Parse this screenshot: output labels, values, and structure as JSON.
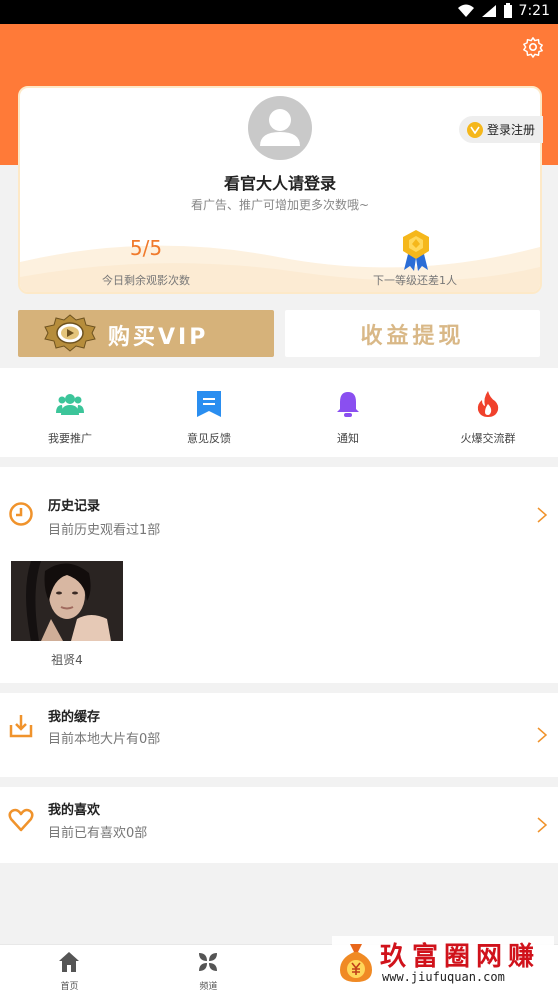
{
  "status_bar": {
    "time": "7:21"
  },
  "profile": {
    "login_title": "看官大人请登录",
    "login_subtitle": "看广告、推广可增加更多次数哦~",
    "views_remaining_value": "5/5",
    "views_remaining_label": "今日剩余观影次数",
    "next_level_label": "下一等级还差1人",
    "login_register_label": "登录注册"
  },
  "actions": {
    "buy_vip_label": "购买VIP",
    "withdraw_label": "收益提现"
  },
  "quick_links": [
    {
      "label": "我要推广",
      "icon": "team-icon",
      "color": "#3cc59a"
    },
    {
      "label": "意见反馈",
      "icon": "feedback-icon",
      "color": "#2a8ef0"
    },
    {
      "label": "通知",
      "icon": "bell-icon",
      "color": "#8a4ff0"
    },
    {
      "label": "火爆交流群",
      "icon": "flame-icon",
      "color": "#f0412c"
    }
  ],
  "history": {
    "title": "历史记录",
    "subtitle": "目前历史观看过1部",
    "items": [
      {
        "title": "祖贤4"
      }
    ]
  },
  "cache": {
    "title": "我的缓存",
    "subtitle": "目前本地大片有0部"
  },
  "favorites": {
    "title": "我的喜欢",
    "subtitle": "目前已有喜欢0部"
  },
  "bottom_nav": [
    {
      "label": "首页",
      "icon": "home-icon"
    },
    {
      "label": "频道",
      "icon": "channel-icon"
    },
    {
      "label": "",
      "icon": ""
    },
    {
      "label": "",
      "icon": ""
    }
  ],
  "watermark": {
    "title": "玖富圈网赚",
    "url": "www.jiufuquan.com"
  },
  "colors": {
    "accent": "#ff7a38",
    "vip_gold": "#d6b27a",
    "withdraw_text": "#d9b887",
    "count_orange": "#f07a2c"
  }
}
